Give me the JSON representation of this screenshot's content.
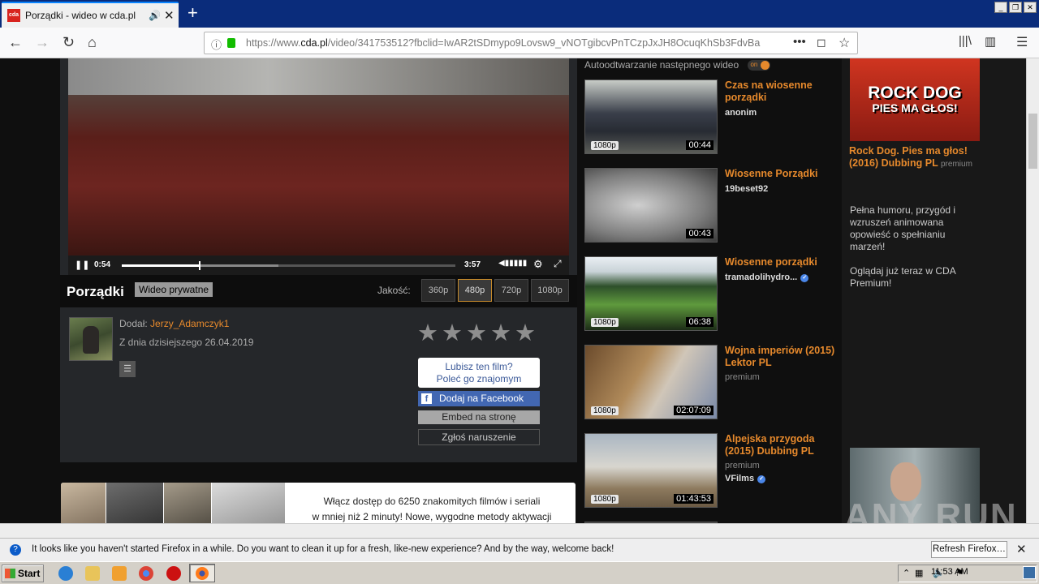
{
  "browser": {
    "tab_title": "Porządki - wideo w cda.pl",
    "favicon_text": "cda",
    "url_prefix": "https://www.",
    "url_domain": "cda.pl",
    "url_rest": "/video/341753512?fbclid=IwAR2tSDmypo9Lovsw9_vNOTgibcvPnTCzpJxJH8OcuqKhSb3FdvBa",
    "notification": "It looks like you haven't started Firefox in a while. Do you want to clean it up for a fresh, like-new experience? And by the way, welcome back!",
    "refresh_button": "Refresh Firefox…"
  },
  "player": {
    "current_time": "0:54",
    "total_time": "3:57",
    "progress_fraction": 0.23,
    "title": "Porządki",
    "private_badge": "Wideo prywatne",
    "quality_label": "Jakość:",
    "qualities": [
      "360p",
      "480p",
      "720p",
      "1080p"
    ],
    "selected_quality": "480p"
  },
  "uploader": {
    "added_label": "Dodał:",
    "name": "Jerzy_Adamczyk1",
    "date": "Z dnia dzisiejszego 26.04.2019"
  },
  "share": {
    "stars": "★★★★★",
    "like_line1": "Lubisz ten film?",
    "like_line2": "Poleć go znajomym",
    "facebook": "Dodaj na Facebook",
    "embed": "Embed na stronę",
    "report": "Zgłoś naruszenie"
  },
  "promo": {
    "line1": "Włącz dostęp do 6250 znakomitych filmów i seriali",
    "line2": "w mniej niż 2 minuty! Nowe, wygodne metody aktywacji"
  },
  "sidebar": {
    "autoplay_label": "Autoodtwarzanie następnego wideo",
    "autoplay_state": "on",
    "items": [
      {
        "title": "Czas na wiosenne porządki",
        "user": "anonim",
        "quality": "1080p",
        "duration": "00:44",
        "premium": "",
        "verified": false
      },
      {
        "title": "Wiosenne Porządki",
        "user": "19beset92",
        "quality": "",
        "duration": "00:43",
        "premium": "",
        "verified": false
      },
      {
        "title": "Wiosenne porządki",
        "user": "tramadolihydro...",
        "quality": "1080p",
        "duration": "06:38",
        "premium": "",
        "verified": true
      },
      {
        "title": "Wojna imperiów (2015) Lektor PL",
        "user": "",
        "quality": "1080p",
        "duration": "02:07:09",
        "premium": "premium",
        "verified": false
      },
      {
        "title": "Alpejska przygoda (2015) Dubbing PL",
        "user": "VFilms",
        "quality": "1080p",
        "duration": "01:43:53",
        "premium": "premium",
        "verified": true
      }
    ]
  },
  "ad": {
    "banner_line1": "ROCK DOG",
    "banner_line2": "PIES MA GŁOS!",
    "title": "Rock Dog. Pies ma głos! (2016) Dubbing PL",
    "premium": "premium",
    "desc1": "Pełna humoru, przygód i wzruszeń animowana opowieść o spełnianiu marzeń!",
    "desc2": "Oglądaj już teraz w CDA Premium!"
  },
  "watermark": "ANY RUN",
  "taskbar": {
    "start": "Start",
    "clock": "11:53 AM"
  },
  "colors": {
    "accent": "#e6892c",
    "firefox_tabbar": "#0a2c7b"
  }
}
